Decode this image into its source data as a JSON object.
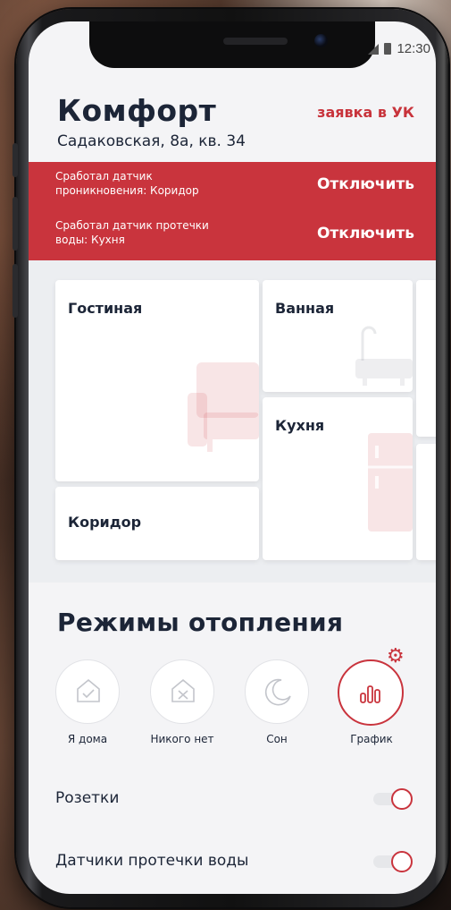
{
  "status_bar": {
    "time": "12:30"
  },
  "header": {
    "title": "Комфорт",
    "address": "Садаковская, 8а, кв. 34",
    "uk_link": "заявка в УК"
  },
  "alerts": [
    {
      "text": "Сработал датчик проникновения: Коридор",
      "action": "Отключить"
    },
    {
      "text": "Сработал датчик протечки воды: Кухня",
      "action": "Отключить"
    }
  ],
  "rooms": {
    "living": "Гостиная",
    "bath": "Ванная",
    "kitchen": "Кухня",
    "corridor": "Коридор"
  },
  "heating": {
    "title": "Режимы отопления",
    "modes": [
      {
        "label": "Я дома",
        "icon": "home-check-icon",
        "active": false
      },
      {
        "label": "Никого нет",
        "icon": "home-x-icon",
        "active": false
      },
      {
        "label": "Сон",
        "icon": "moon-icon",
        "active": false
      },
      {
        "label": "График",
        "icon": "schedule-chart-icon",
        "active": true
      }
    ]
  },
  "toggles": [
    {
      "label": "Розетки",
      "on": true
    },
    {
      "label": "Датчики протечки воды",
      "on": true
    }
  ],
  "colors": {
    "accent": "#c9343d",
    "text": "#1c2537",
    "background": "#f4f4f6"
  }
}
